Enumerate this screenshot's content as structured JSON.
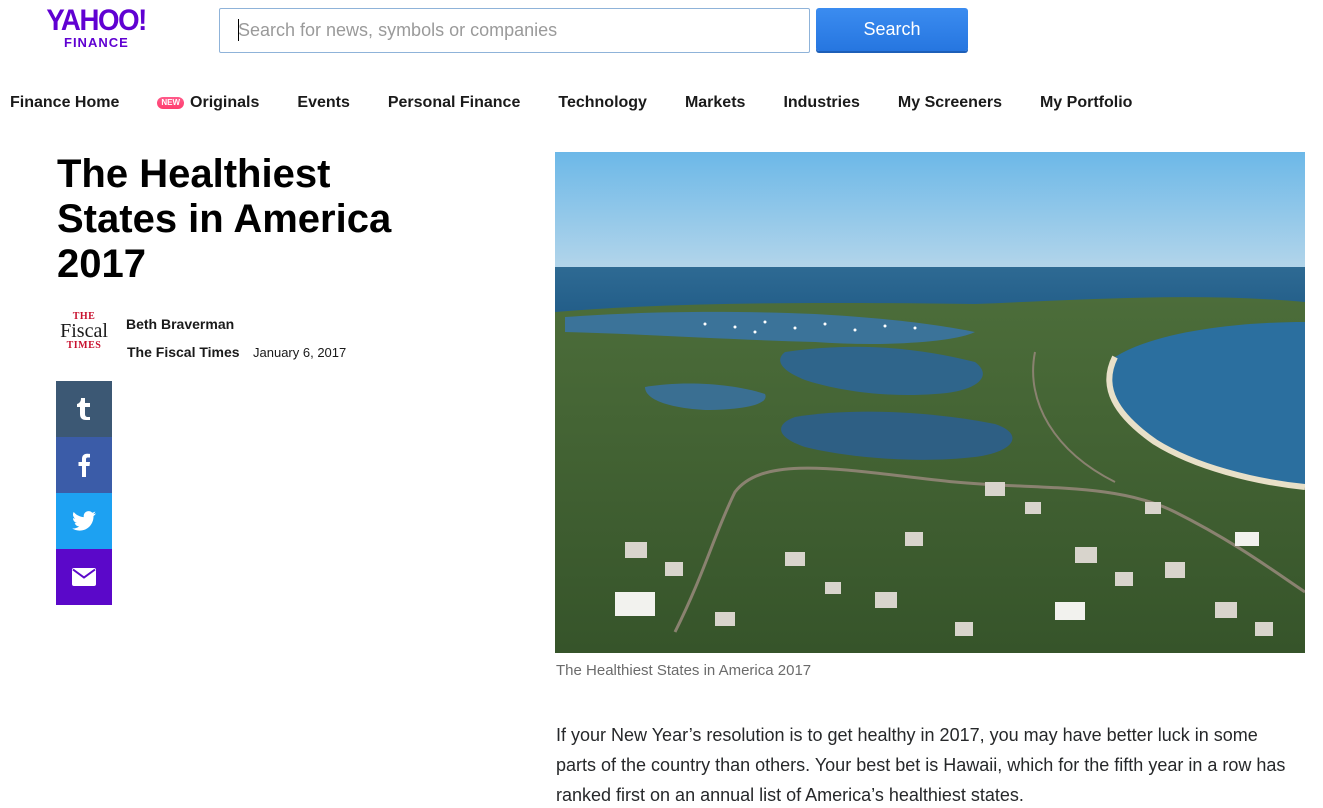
{
  "header": {
    "logo_main": "YAHOO!",
    "logo_sub": "FINANCE",
    "search_placeholder": "Search for news, symbols or companies",
    "search_button_label": "Search",
    "accent_color": "#6001d2",
    "search_button_color": "#2f80ed"
  },
  "nav": {
    "items": [
      {
        "label": "Finance Home"
      },
      {
        "label": "Originals",
        "badge": "NEW"
      },
      {
        "label": "Events"
      },
      {
        "label": "Personal Finance"
      },
      {
        "label": "Technology"
      },
      {
        "label": "Markets"
      },
      {
        "label": "Industries"
      },
      {
        "label": "My Screeners"
      },
      {
        "label": "My Portfolio"
      }
    ]
  },
  "article": {
    "title": "The Healthiest States in America 2017",
    "source_logo": {
      "line1": "THE",
      "line2": "Fiscal",
      "line3": "TIMES"
    },
    "author": "Beth Braverman",
    "publisher": "The Fiscal Times",
    "date": "January 6, 2017",
    "share": [
      {
        "icon": "tumblr-icon",
        "color": "#3c5874"
      },
      {
        "icon": "facebook-icon",
        "color": "#3b5ca8"
      },
      {
        "icon": "twitter-icon",
        "color": "#1da1f2"
      },
      {
        "icon": "mail-icon",
        "color": "#5b08c9"
      }
    ],
    "caption": "The Healthiest States in America 2017",
    "body": "If your New Year’s resolution is to get healthy in 2017, you may have better luck in some parts of the country than others. Your best bet is Hawaii, which for the fifth year in a row has ranked first on an annual list of America’s healthiest states."
  }
}
